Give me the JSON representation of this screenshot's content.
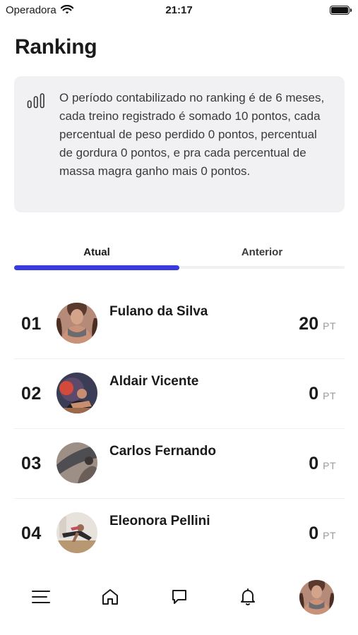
{
  "status_bar": {
    "carrier": "Operadora",
    "time": "21:17"
  },
  "page": {
    "title": "Ranking"
  },
  "info": {
    "text": "O período contabilizado no ranking é de 6 meses, cada treino registrado é somado 10 pontos, cada percentual de peso perdido 0 pontos, percentual de gordura 0 pontos, e pra cada percentual de massa magra ganho mais 0 pontos."
  },
  "tabs": [
    {
      "label": "Atual",
      "active": true
    },
    {
      "label": "Anterior",
      "active": false
    }
  ],
  "ranking": [
    {
      "position": "01",
      "name": "Fulano da Silva",
      "score": "20",
      "unit": "PT"
    },
    {
      "position": "02",
      "name": "Aldair Vicente",
      "score": "0",
      "unit": "PT"
    },
    {
      "position": "03",
      "name": "Carlos Fernando",
      "score": "0",
      "unit": "PT"
    },
    {
      "position": "04",
      "name": "Eleonora Pellini",
      "score": "0",
      "unit": "PT"
    }
  ],
  "bottom_nav": {
    "items": [
      "menu-icon",
      "home-icon",
      "chat-icon",
      "bell-icon",
      "profile-avatar"
    ]
  },
  "colors": {
    "accent": "#3a3bdc",
    "card_bg": "#f1f1f3",
    "muted": "#9a9aa0"
  }
}
